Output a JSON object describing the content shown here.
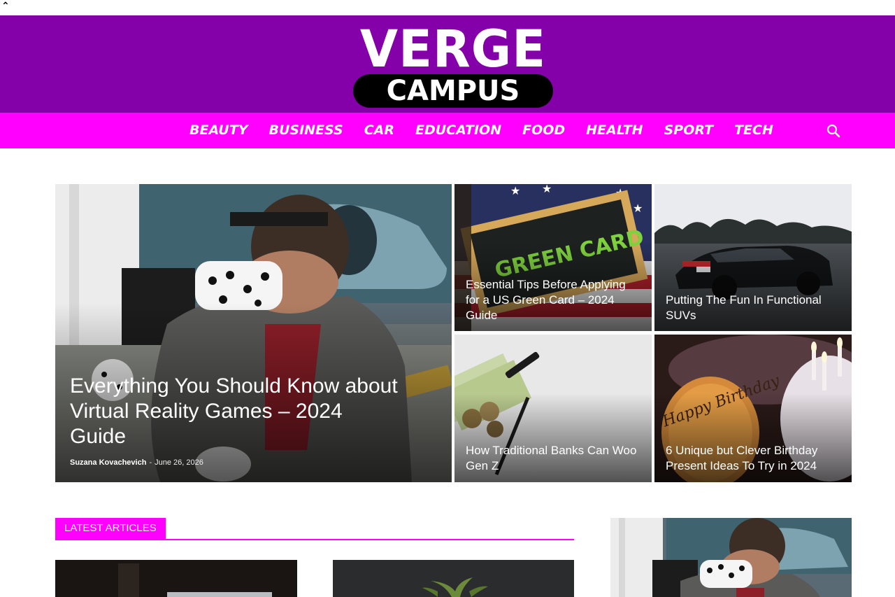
{
  "header": {
    "scroll_top_glyph": "⌃",
    "logo_top": "VERGE",
    "logo_bottom": "CAMPUS"
  },
  "nav": {
    "items": [
      "BEAUTY",
      "BUSINESS",
      "CAR",
      "EDUCATION",
      "FOOD",
      "HEALTH",
      "SPORT",
      "TECH"
    ],
    "search_icon": "search-icon"
  },
  "featured": {
    "main": {
      "title": "Everything You Should Know about Virtual Reality Games – 2024 Guide",
      "author": "Suzana Kovachevich",
      "separator": "-",
      "date": "June 26, 2026"
    },
    "tiles": [
      {
        "title": "Essential Tips Before Applying for a US Green Card – 2024 Guide",
        "image_text": "GREEN CARD"
      },
      {
        "title": "Putting The Fun In Functional SUVs"
      },
      {
        "title": "How Traditional Banks Can Woo Gen Z"
      },
      {
        "title": "6 Unique but Clever Birthday Present Ideas To Try in 2024",
        "image_text": "Happy Birthday"
      }
    ]
  },
  "latest": {
    "label": "LATEST ARTICLES"
  },
  "colors": {
    "brand_purple": "#8400a8",
    "nav_magenta": "#ff00ff"
  }
}
